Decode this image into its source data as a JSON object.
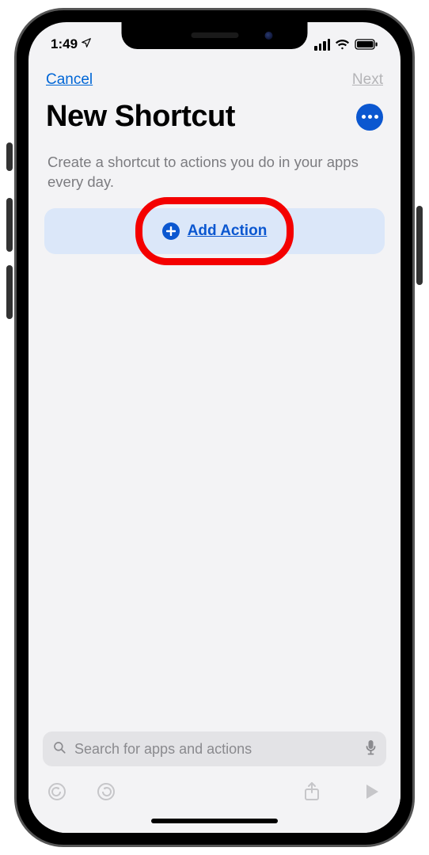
{
  "status": {
    "time": "1:49",
    "location_icon": "location-arrow-icon",
    "signal": 4,
    "wifi": 3,
    "battery_pct": 95
  },
  "nav": {
    "cancel_label": "Cancel",
    "next_label": "Next"
  },
  "title": "New Shortcut",
  "more_menu_icon": "ellipsis-icon",
  "description": "Create a shortcut to actions you do in your apps every day.",
  "add_action": {
    "label": "Add Action",
    "plus_icon": "plus-circle-icon"
  },
  "highlight": {
    "target": "add-action-button",
    "color": "#f40000"
  },
  "search": {
    "placeholder": "Search for apps and actions",
    "left_icon": "search-icon",
    "right_icon": "microphone-icon",
    "value": ""
  },
  "toolbar": {
    "undo_icon": "undo-icon",
    "redo_icon": "redo-icon",
    "share_icon": "share-icon",
    "play_icon": "play-icon",
    "enabled": false
  }
}
